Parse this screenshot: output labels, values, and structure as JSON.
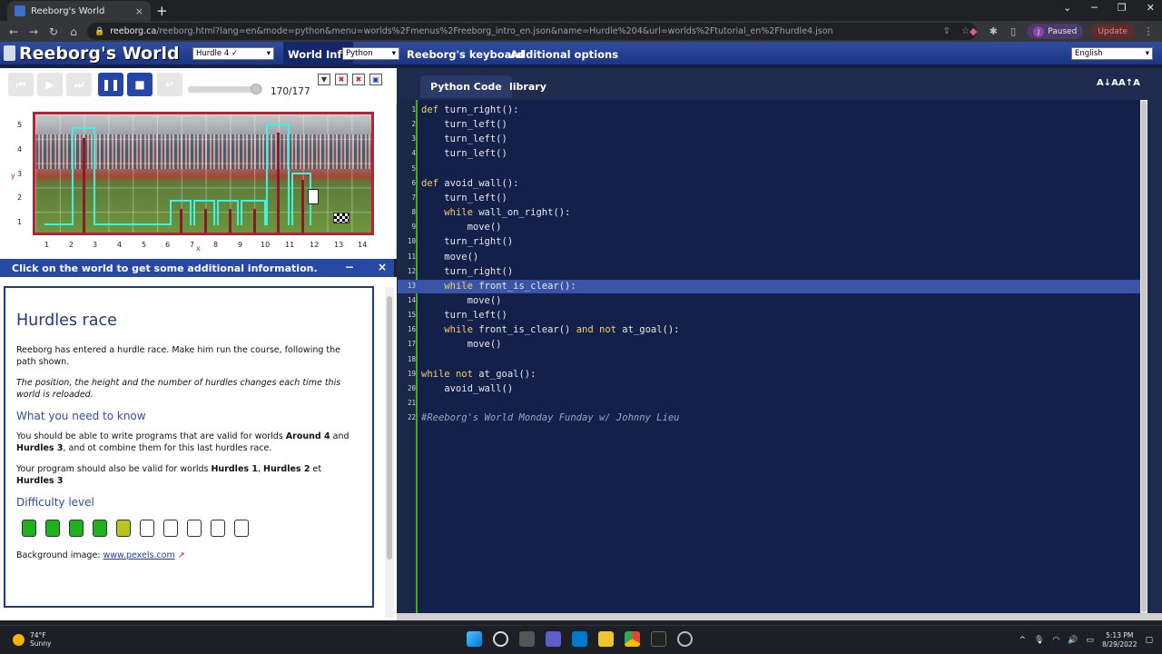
{
  "browser": {
    "tab_title": "Reeborg's World",
    "tab_close": "×",
    "new_tab": "+",
    "url_host": "reeborg.ca",
    "url_path": "/reeborg.html?lang=en&mode=python&menu=worlds%2Fmenus%2Freeborg_intro_en.json&name=Hurdle%204&url=worlds%2Ftutorial_en%2Fhurdle4.json",
    "profile_initial": "J",
    "profile_label": "Paused",
    "update_label": "Update"
  },
  "app": {
    "logo": "Reeborg's World",
    "world_select": "Hurdle 4 ✓",
    "world_info": "World Info",
    "language_select": "Python",
    "keyboard": "Reeborg's keyboard",
    "additional_options": "Additional options",
    "ui_language": "English"
  },
  "controls": {
    "step_counter": "170/177",
    "progress": 0.96
  },
  "world": {
    "y_axis_label": "y",
    "x_axis_label": "x",
    "y_ticks": [
      "5",
      "4",
      "3",
      "2",
      "1"
    ],
    "x_ticks": [
      "1",
      "2",
      "3",
      "4",
      "5",
      "6",
      "7",
      "8",
      "9",
      "10",
      "11",
      "12",
      "13",
      "14"
    ]
  },
  "info": {
    "bar_text": "Click on the world to get some additional information.",
    "minimize": "−",
    "close": "×",
    "title": "Hurdles race",
    "p1": "Reeborg has entered a hurdle race. Make him run the course, following the path shown.",
    "p2": "The position, the height and the number of hurdles changes each time this world is reloaded.",
    "h_know": "What you need to know",
    "p3_a": "You should be able to write programs that are valid for worlds ",
    "p3_b1": "Around 4",
    "p3_c": " and ",
    "p3_b2": "Hurdles 3",
    "p3_d": ", and ot combine them for this last hurdles race.",
    "p4_a": "Your program should also be valid for worlds ",
    "p4_b1": "Hurdles 1",
    "p4_c": ", ",
    "p4_b2": "Hurdles 2",
    "p4_d": " et ",
    "p4_b3": "Hurdles 3",
    "h_diff": "Difficulty level",
    "difficulty_level": 5,
    "difficulty_max": 10,
    "bg_label": "Background image: ",
    "bg_link": "www.pexels.com"
  },
  "editor": {
    "tab_python": "Python Code",
    "tab_library": "library",
    "font_smaller": "A↓A",
    "font_larger": "A↑A",
    "highlight_line": 13,
    "lines": [
      "def turn_right():",
      "    turn_left()",
      "    turn_left()",
      "    turn_left()",
      "",
      "def avoid_wall():",
      "    turn_left()",
      "    while wall_on_right():",
      "        move()",
      "    turn_right()",
      "    move()",
      "    turn_right()",
      "    while front_is_clear():",
      "        move()",
      "    turn_left()",
      "    while front_is_clear() and not at_goal():",
      "        move()",
      "",
      "while not at_goal():",
      "    avoid_wall()",
      "",
      "#Reeborg's World Monday Funday w/ Johnny Lieu"
    ]
  },
  "taskbar": {
    "temp": "74°F",
    "condition": "Sunny",
    "time": "5:13 PM",
    "date": "8/29/2022"
  },
  "colors": {
    "app_blue": "#2749a4",
    "editor_bg": "#13204a",
    "keyword": "#f0d06a",
    "wall": "#8b1a2a",
    "path": "#3ff3e3"
  }
}
